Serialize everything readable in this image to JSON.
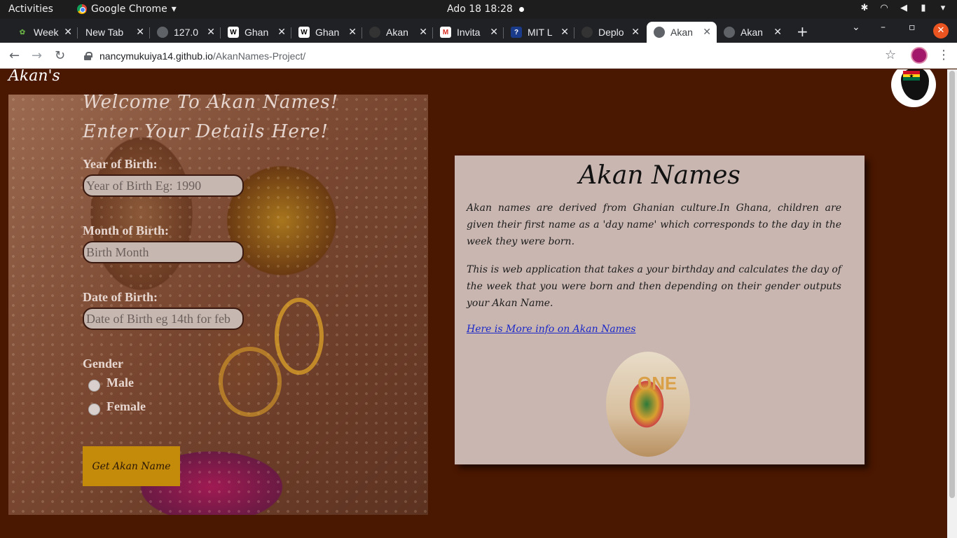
{
  "system": {
    "activities": "Activities",
    "app_name": "Google Chrome",
    "clock": "Ado 18  18:28"
  },
  "tabs": [
    {
      "title": "Week",
      "favicon": "leaf-icon"
    },
    {
      "title": "New Tab",
      "favicon": "none"
    },
    {
      "title": "127.0",
      "favicon": "globe-icon"
    },
    {
      "title": "Ghan",
      "favicon": "wikipedia-icon"
    },
    {
      "title": "Ghan",
      "favicon": "wikipedia-icon"
    },
    {
      "title": "Akan",
      "favicon": "github-icon"
    },
    {
      "title": "Invita",
      "favicon": "gmail-icon"
    },
    {
      "title": "MIT L",
      "favicon": "question-icon"
    },
    {
      "title": "Deplo",
      "favicon": "github-icon"
    },
    {
      "title": "Akan",
      "favicon": "globe-icon",
      "active": true
    },
    {
      "title": "Akan",
      "favicon": "globe-icon"
    }
  ],
  "address_bar": {
    "host": "nancymukuiya14.github.io",
    "path": "/AkanNames-Project/"
  },
  "page": {
    "brand": "Akan's",
    "form": {
      "welcome": "Welcome To Akan Names!",
      "subtitle": "Enter Your Details Here!",
      "year_label": "Year of Birth:",
      "year_placeholder": "Year of Birth Eg: 1990",
      "month_label": "Month of Birth:",
      "month_placeholder": "Birth Month",
      "date_label": "Date of Birth:",
      "date_placeholder": "Date of Birth eg 14th for feb",
      "gender_label": "Gender",
      "male_label": "Male",
      "female_label": "Female",
      "submit_label": "Get Akan Name"
    },
    "card": {
      "title": "Akan Names",
      "para1": "Akan names are derived from Ghanian culture.In Ghana, children are given their first name as a 'day name' which corresponds to the day in the week they were born.",
      "para2": "This is web application that takes a your birthday and calculates the day of the week that you were born and then depending on their gender outputs your Akan Name.",
      "link": "Here is More info on Akan Names",
      "photo_text": "ONE"
    }
  },
  "colors": {
    "page_bg": "#4a1700",
    "card_bg": "#c9b6b0",
    "button_bg": "#c48b0b",
    "link": "#1a28c8",
    "ghana_flag": [
      "#ce1126",
      "#fcd116",
      "#006b3f"
    ]
  }
}
